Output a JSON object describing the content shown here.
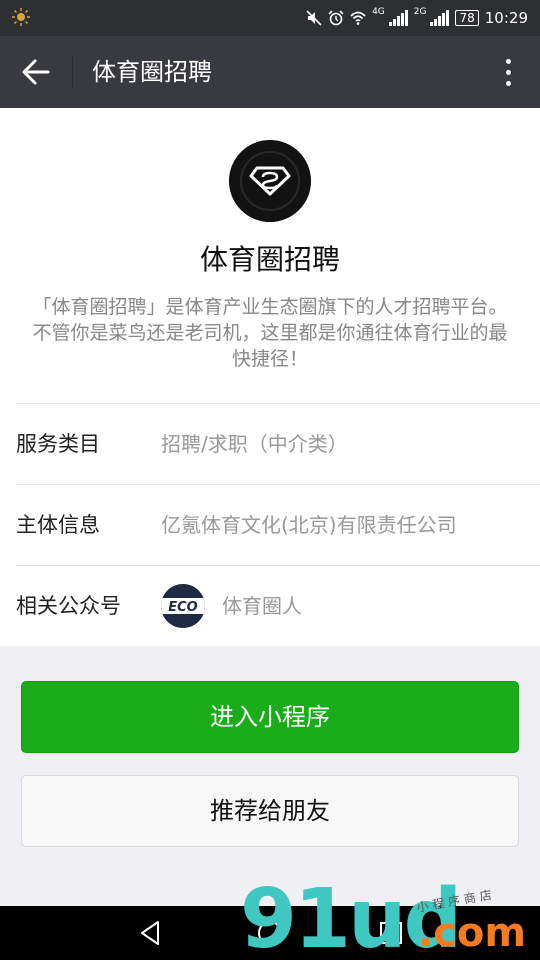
{
  "status_bar": {
    "net_4g": "4G",
    "net_2g": "2G",
    "battery": "78",
    "time": "10:29"
  },
  "title_bar": {
    "title": "体育圈招聘"
  },
  "profile": {
    "name": "体育圈招聘",
    "description": "「体育圈招聘」是体育产业生态圈旗下的人才招聘平台。不管你是菜鸟还是老司机，这里都是你通往体育行业的最快捷径！"
  },
  "details": {
    "service_label": "服务类目",
    "service_value": "招聘/求职（中介类）",
    "entity_label": "主体信息",
    "entity_value": "亿氪体育文化(北京)有限责任公司",
    "account_label": "相关公众号",
    "account_name": "体育圈人",
    "account_logo_text": "ECO"
  },
  "buttons": {
    "enter": "进入小程序",
    "recommend": "推荐给朋友"
  },
  "watermark": {
    "big": "91ud",
    "com": ".com",
    "small": "小程序商店"
  },
  "colors": {
    "primary_green": "#1aad19",
    "title_bar_bg": "#393a3f",
    "status_bar_bg": "#2e2f33"
  }
}
